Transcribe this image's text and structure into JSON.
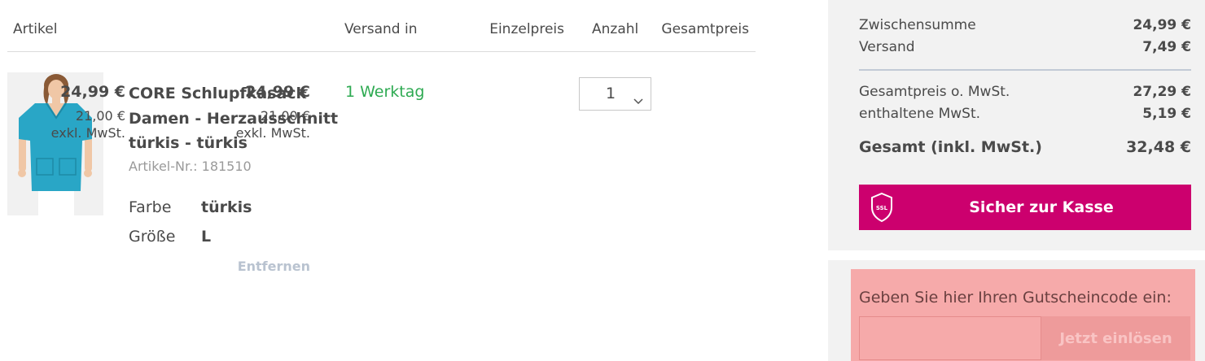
{
  "cart": {
    "headers": {
      "article": "Artikel",
      "shipping": "Versand in",
      "unit_price": "Einzelpreis",
      "quantity": "Anzahl",
      "total_price": "Gesamtpreis"
    },
    "item": {
      "image_alt": "Schlupfkasack türkis",
      "name_lines": [
        "CORE Schlupfkasack",
        "Damen - Herzausschnitt",
        "türkis - türkis"
      ],
      "sku": "Artikel-Nr.: 181510",
      "attributes": [
        {
          "label": "Farbe",
          "value": "türkis"
        },
        {
          "label": "Größe",
          "value": "L"
        }
      ],
      "delivery": "1 Werktag",
      "unit_price": "24,99 €",
      "unit_price_net": "21,00 €",
      "unit_price_net_note": "exkl. MwSt.",
      "quantity": "1",
      "total_price": "24,99 €",
      "total_price_net": "21,00 €",
      "total_price_net_note": "exkl. MwSt.",
      "remove_label": "Entfernen"
    }
  },
  "summary": {
    "subtotal_label": "Zwischensumme",
    "subtotal_value": "24,99 €",
    "shipping_label": "Versand",
    "shipping_value": "7,49 €",
    "net_total_label": "Gesamtpreis o. MwSt.",
    "net_total_value": "27,29 €",
    "vat_label": "enthaltene MwSt.",
    "vat_value": "5,19 €",
    "grand_total_label": "Gesamt (inkl. MwSt.)",
    "grand_total_value": "32,48 €",
    "checkout_label": "Sicher zur Kasse",
    "ssl_badge": "SSL"
  },
  "coupon": {
    "label": "Geben Sie hier Ihren Gutscheincode ein:",
    "input_value": "",
    "redeem_label": "Jetzt einlösen"
  },
  "colors": {
    "brand": "#cc006e",
    "delivery_green": "#2eaa52",
    "coupon_bg": "#f6aaaa",
    "summary_bg": "#f2f2f2",
    "remove_link": "#b9c3d0"
  },
  "icons": {
    "quantity_dropdown": "chevron-down-icon",
    "checkout_badge": "ssl-shield-icon"
  }
}
